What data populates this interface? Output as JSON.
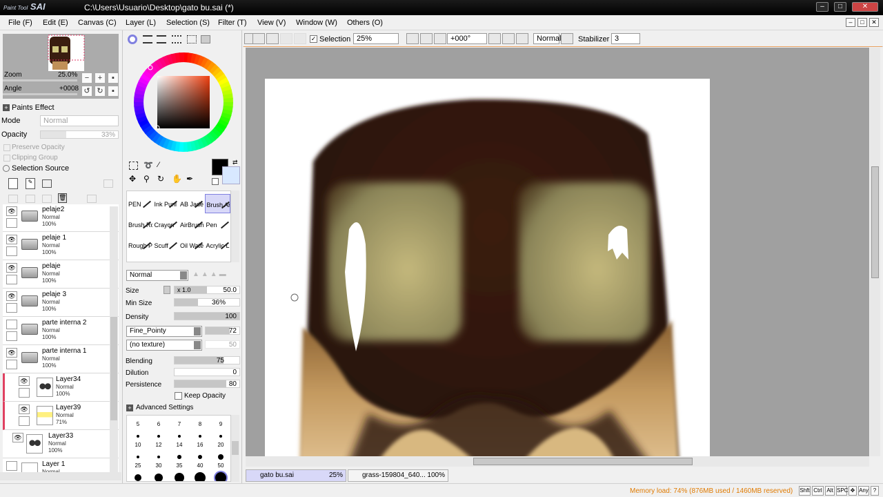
{
  "window": {
    "logo": "Paint Tool",
    "logo_big": "SAI",
    "title": "C:\\Users\\Usuario\\Desktop\\gato bu.sai (*)"
  },
  "menu": [
    "File (F)",
    "Edit (E)",
    "Canvas (C)",
    "Layer (L)",
    "Selection (S)",
    "Filter (T)",
    "View (V)",
    "Window (W)",
    "Others (O)"
  ],
  "navigator": {
    "zoom_label": "Zoom",
    "zoom_value": "25.0%",
    "angle_label": "Angle",
    "angle_value": "+0008"
  },
  "paint_effect": {
    "header": "Paints Effect",
    "mode_label": "Mode",
    "mode_value": "Normal",
    "opacity_label": "Opacity",
    "opacity_value": "33%",
    "preserve_opacity": "Preserve Opacity",
    "clipping_group": "Clipping Group",
    "selection_source": "Selection Source"
  },
  "layers": [
    {
      "name": "pelaje2",
      "mode": "Normal",
      "opacity": "100%",
      "kind": "folder"
    },
    {
      "name": "pelaje 1",
      "mode": "Normal",
      "opacity": "100%",
      "kind": "folder"
    },
    {
      "name": "pelaje",
      "mode": "Normal",
      "opacity": "100%",
      "kind": "folder"
    },
    {
      "name": "pelaje 3",
      "mode": "Normal",
      "opacity": "100%",
      "kind": "folder"
    },
    {
      "name": "parte interna 2",
      "mode": "Normal",
      "opacity": "100%",
      "kind": "folder"
    },
    {
      "name": "parte interna 1",
      "mode": "Normal",
      "opacity": "100%",
      "kind": "folder"
    },
    {
      "name": "Layer34",
      "mode": "Normal",
      "opacity": "100%",
      "kind": "layer"
    },
    {
      "name": "Layer39",
      "mode": "Normal",
      "opacity": "71%",
      "kind": "layer"
    },
    {
      "name": "Layer33",
      "mode": "Normal",
      "opacity": "100%",
      "kind": "layer"
    },
    {
      "name": "Layer 1",
      "mode": "Normal",
      "opacity": "",
      "kind": "layer"
    }
  ],
  "brushes": [
    "PEN",
    "Ink Punl",
    "AB Jade",
    "Brush Ar",
    "Brush Ro",
    "Crayon",
    "AirBrush",
    "Pen",
    "Rough P",
    "Scuff",
    "Oil Wate",
    "Acrylic L"
  ],
  "brush_settings": {
    "blend_mode": "Normal",
    "size_label": "Size",
    "size_mult": "x 1.0",
    "size_value": "50.0",
    "minsize_label": "Min Size",
    "minsize_value": "36%",
    "density_label": "Density",
    "density_value": "100",
    "shape": "Fine_Pointy",
    "shape_value": "72",
    "texture": "(no texture)",
    "texture_value": "50",
    "blending_label": "Blending",
    "blending_value": "75",
    "dilution_label": "Dilution",
    "dilution_value": "0",
    "persistence_label": "Persistence",
    "persistence_value": "80",
    "keep_opacity": "Keep Opacity",
    "advanced": "Advanced Settings"
  },
  "brush_sizes": [
    "5",
    "6",
    "7",
    "8",
    "9",
    "10",
    "12",
    "14",
    "16",
    "20",
    "25",
    "30",
    "35",
    "40",
    "50"
  ],
  "canvas_toolbar": {
    "selection_label": "Selection",
    "zoom": "25%",
    "angle": "+000°",
    "mode": "Normal",
    "stabilizer_label": "Stabilizer",
    "stabilizer_value": "3"
  },
  "tabs": [
    {
      "name": "gato bu.sai",
      "zoom": "25%"
    },
    {
      "name": "grass-159804_640...",
      "zoom": "100%"
    }
  ],
  "status": {
    "memory": "Memory load: 74% (876MB used / 1460MB reserved)",
    "keys": [
      "Shft",
      "Ctrl",
      "Alt",
      "SPC",
      "Any"
    ]
  },
  "colors": {
    "accent": "#8080e0",
    "fur_dark": "#2a130b",
    "eye": "#a8a068",
    "fur_light": "#b89058",
    "memory_text": "#e07a00",
    "current_color": "#000000"
  }
}
